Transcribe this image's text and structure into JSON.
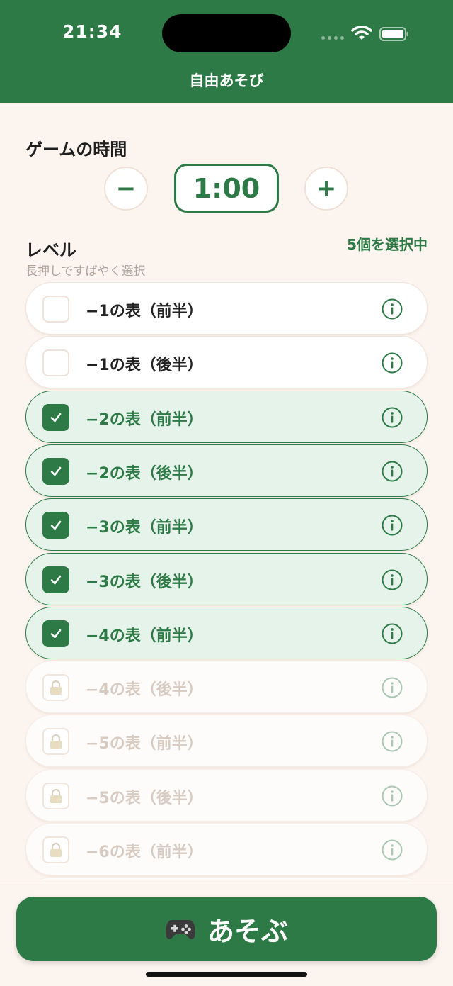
{
  "status_bar": {
    "time": "21:34"
  },
  "nav": {
    "title": "自由あそび"
  },
  "game_time": {
    "title": "ゲームの時間",
    "minus_label": "−",
    "plus_label": "+",
    "value": "1:00"
  },
  "levels": {
    "title": "レベル",
    "hint": "長押しですばやく選択",
    "selected_count": "5個を選択中",
    "items": [
      {
        "label": "−1の表（前半）",
        "state": "unchecked"
      },
      {
        "label": "−1の表（後半）",
        "state": "unchecked"
      },
      {
        "label": "−2の表（前半）",
        "state": "checked"
      },
      {
        "label": "−2の表（後半）",
        "state": "checked"
      },
      {
        "label": "−3の表（前半）",
        "state": "checked"
      },
      {
        "label": "−3の表（後半）",
        "state": "checked"
      },
      {
        "label": "−4の表（前半）",
        "state": "checked"
      },
      {
        "label": "−4の表（後半）",
        "state": "locked"
      },
      {
        "label": "−5の表（前半）",
        "state": "locked"
      },
      {
        "label": "−5の表（後半）",
        "state": "locked"
      },
      {
        "label": "−6の表（前半）",
        "state": "locked"
      },
      {
        "label": "",
        "state": "locked"
      }
    ]
  },
  "play_button": {
    "label": "あそぶ",
    "icon": "gamepad-icon"
  },
  "colors": {
    "accent": "#2d7a47",
    "background": "#fcf4ef",
    "selected_row": "#e5f3eb"
  }
}
